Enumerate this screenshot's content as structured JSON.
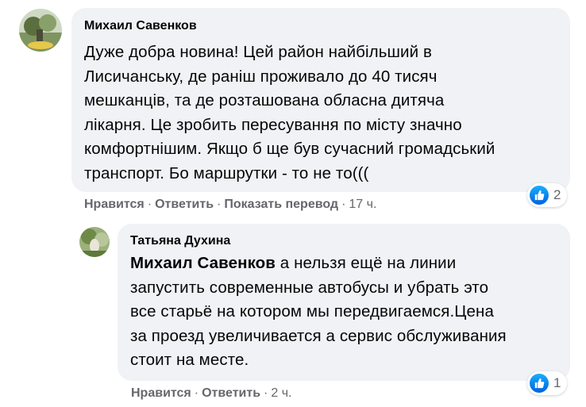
{
  "comments": [
    {
      "author": "Михаил Савенков",
      "lines": [
        "Дуже добра новина! Цей район найбільший в",
        "Лисичанську, де раніш проживало до 40 тисяч",
        "мешканців, та де розташована обласна дитяча",
        "лікарня. Це зробить пересування по місту значно",
        "комфортнішим. Якщо б ще був сучасний громадський",
        "транспорт. Бо маршрутки - то не то((("
      ],
      "actions": {
        "like": "Нравится",
        "reply": "Ответить",
        "translate": "Показать перевод",
        "time": "17 ч."
      },
      "reaction_icon": "like-icon",
      "reaction_count": "2"
    },
    {
      "author": "Татьяна Духина",
      "mention": "Михаил Савенков",
      "first_line_rest": " а нельзя ещё на линии",
      "lines": [
        "запустить современные автобусы и убрать это",
        "все старьё на котором мы передвигаемся.Цена",
        "за проезд увеличивается а сервис обслуживания",
        "стоит на месте."
      ],
      "actions": {
        "like": "Нравится",
        "reply": "Ответить",
        "time": "2 ч."
      },
      "reaction_icon": "like-icon",
      "reaction_count": "1"
    }
  ],
  "separator": "·",
  "colors": {
    "bubble": "#f0f2f5",
    "meta": "#65676b",
    "like_blue": "#0866ff"
  }
}
